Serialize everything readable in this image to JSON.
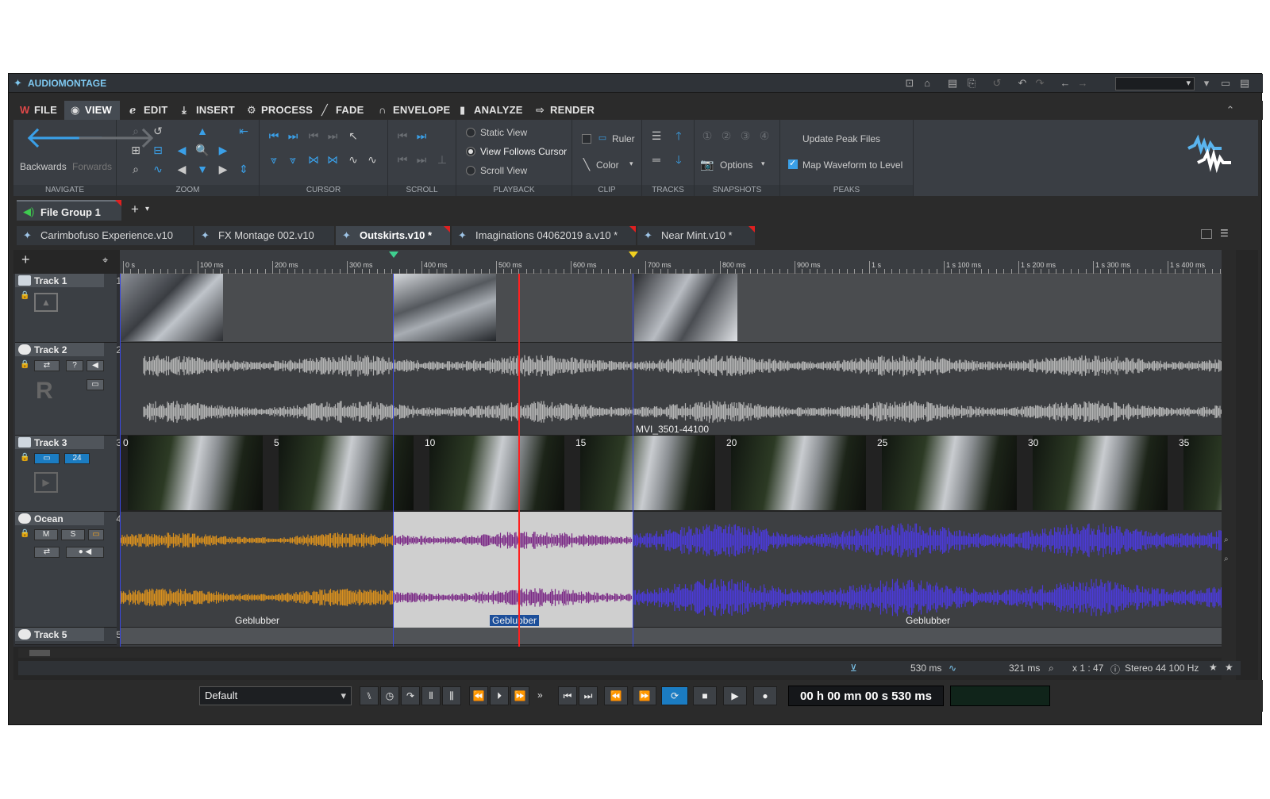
{
  "app": {
    "title": "AUDIOMONTAGE"
  },
  "menu": [
    {
      "label": "FILE",
      "icon": "wavelab-logo-icon"
    },
    {
      "label": "VIEW",
      "icon": "eye-icon"
    },
    {
      "label": "EDIT",
      "icon": "edit-icon"
    },
    {
      "label": "INSERT",
      "icon": "insert-icon"
    },
    {
      "label": "PROCESS",
      "icon": "process-icon"
    },
    {
      "label": "FADE",
      "icon": "fade-icon"
    },
    {
      "label": "ENVELOPE",
      "icon": "envelope-icon"
    },
    {
      "label": "ANALYZE",
      "icon": "analyze-icon"
    },
    {
      "label": "RENDER",
      "icon": "render-icon"
    }
  ],
  "ribbon": {
    "navigate": {
      "label": "NAVIGATE",
      "backwards": "Backwards",
      "forwards": "Forwards"
    },
    "zoom": {
      "label": "ZOOM"
    },
    "cursor": {
      "label": "CURSOR"
    },
    "scroll": {
      "label": "SCROLL"
    },
    "playback": {
      "label": "PLAYBACK",
      "static_view": "Static View",
      "view_follows_cursor": "View Follows Cursor",
      "scroll_view": "Scroll View",
      "selected": "View Follows Cursor"
    },
    "clip": {
      "label": "CLIP",
      "ruler": "Ruler",
      "color": "Color"
    },
    "tracks": {
      "label": "TRACKS"
    },
    "snapshots": {
      "label": "SNAPSHOTS",
      "options": "Options"
    },
    "peaks": {
      "label": "PEAKS",
      "update": "Update Peak Files",
      "map": "Map Waveform to Level",
      "map_checked": true
    }
  },
  "file_group": {
    "label": "File Group 1"
  },
  "doc_tabs": [
    {
      "label": "Carimbofuso Experience.v10",
      "modified": false
    },
    {
      "label": "FX Montage 002.v10",
      "modified": false
    },
    {
      "label": "Outskirts.v10 *",
      "modified": true,
      "active": true
    },
    {
      "label": "Imaginations 04062019 a.v10 *",
      "modified": true
    },
    {
      "label": "Near Mint.v10 *",
      "modified": true
    }
  ],
  "ruler": {
    "labels": [
      "0 s",
      "100 ms",
      "200 ms",
      "300 ms",
      "400 ms",
      "500 ms",
      "600 ms",
      "700 ms",
      "800 ms",
      "900 ms",
      "1 s",
      "1 s 100 ms",
      "1 s 200 ms",
      "1 s 300 ms",
      "1 s 400 ms"
    ]
  },
  "tracks": [
    {
      "name": "Track 1",
      "num": "1",
      "type": "image"
    },
    {
      "name": "Track 2",
      "num": "2",
      "type": "stereo"
    },
    {
      "name": "Track 3",
      "num": "3",
      "type": "video"
    },
    {
      "name": "Ocean",
      "num": "4",
      "type": "stereo"
    },
    {
      "name": "Track 5",
      "num": "5",
      "type": "audio"
    }
  ],
  "track2": {
    "letter": "R",
    "clip_name": "MVI_3501-44100"
  },
  "track3": {
    "frame_numbers": [
      "0",
      "5",
      "10",
      "15",
      "20",
      "25",
      "30",
      "35"
    ]
  },
  "ocean": {
    "clips": [
      "Geblubber",
      "Geblubber",
      "Geblubber"
    ],
    "buttons": {
      "mute": "M",
      "solo": "S"
    },
    "colors": {
      "orange": "#d9901e",
      "purple": "#7b2a86",
      "blue": "#4b3ad8"
    }
  },
  "status": {
    "cursor": "530 ms",
    "length": "321 ms",
    "zoom": "x 1 : 47",
    "format": "Stereo 44 100 Hz"
  },
  "transport": {
    "preset": "Default",
    "timecode": "00 h 00 mn 00 s 530 ms"
  },
  "colors": {
    "accent": "#3aa0e8",
    "playhead": "#ff2020"
  }
}
